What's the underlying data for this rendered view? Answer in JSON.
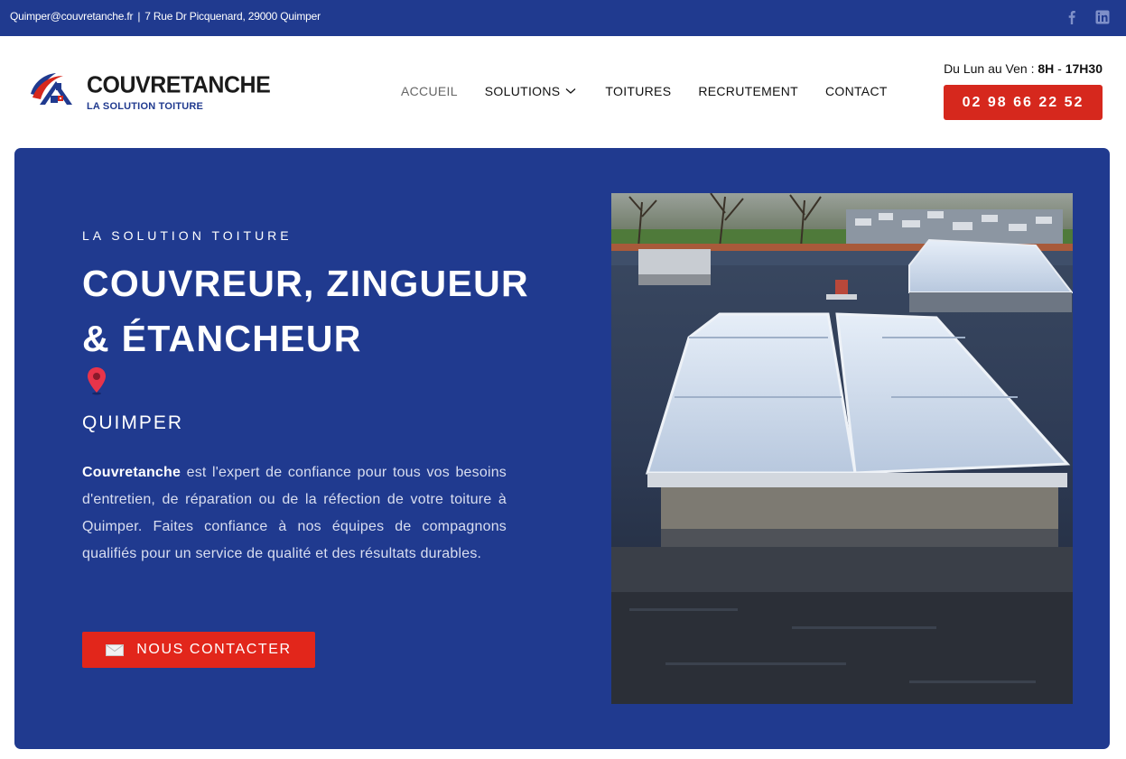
{
  "topbar": {
    "email": "Quimper@couvretanche.fr",
    "separator": "|",
    "address": "7 Rue Dr Picquenard, 29000 Quimper",
    "social": [
      "facebook-icon",
      "linkedin-icon"
    ]
  },
  "header": {
    "brand_name": "COUVRETANCHE",
    "brand_tagline": "LA SOLUTION TOITURE",
    "nav": [
      {
        "label": "ACCUEIL",
        "active": true
      },
      {
        "label": "SOLUTIONS",
        "has_dropdown": true
      },
      {
        "label": "TOITURES"
      },
      {
        "label": "RECRUTEMENT"
      },
      {
        "label": "CONTACT"
      }
    ],
    "hours_prefix": "Du Lun au Ven :",
    "hours_start": "8H",
    "hours_dash": "-",
    "hours_end": "17H30",
    "phone": "02 98 66 22 52"
  },
  "hero": {
    "kicker": "LA SOLUTION TOITURE",
    "title_line1": "COUVREUR, ZINGUEUR",
    "title_line2": "& ÉTANCHEUR",
    "city": "QUIMPER",
    "desc_bold": "Couvretanche",
    "desc_rest": " est l'expert de confiance pour tous vos besoins d'entretien, de réparation ou de la réfection de votre toiture à Quimper. Faites confiance à nos équipes de compagnons qualifiés pour un service de qualité et des résultats durables.",
    "cta_label": "NOUS CONTACTER",
    "cta_icon": "envelope-icon",
    "pin_icon": "location-pin-icon"
  },
  "colors": {
    "brand_blue": "#203a8f",
    "accent_red": "#d6281d"
  }
}
